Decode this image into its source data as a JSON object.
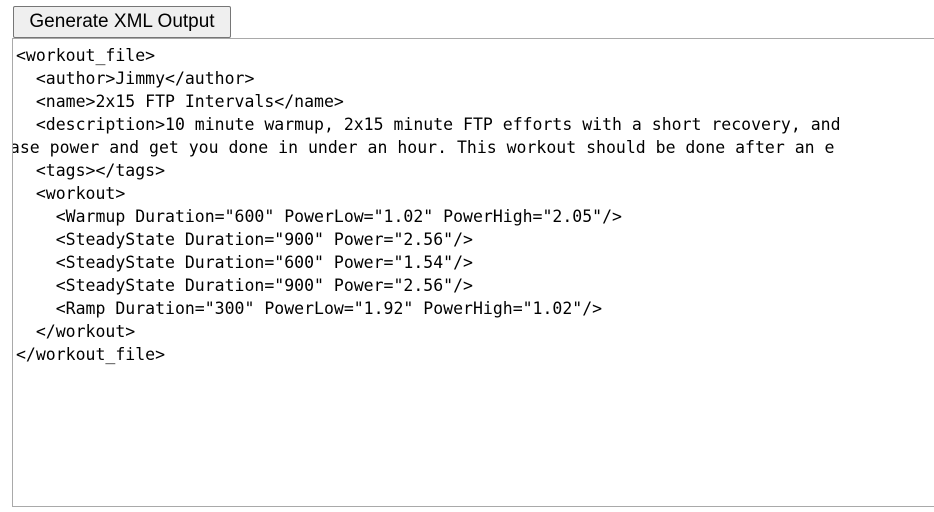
{
  "toolbar": {
    "generate_label": "Generate XML Output"
  },
  "xml_output": {
    "lines": [
      "<workout_file>",
      "  <author>Jimmy</author>",
      "  <name>2x15 FTP Intervals</name>",
      "  <description>10 minute warmup, 2x15 minute FTP efforts with a short recovery, and",
      "base power and get you done in under an hour. This workout should be done after an e",
      "  <tags></tags>",
      "  <workout>",
      "    <Warmup Duration=\"600\" PowerLow=\"1.02\" PowerHigh=\"2.05\"/>",
      "    <SteadyState Duration=\"900\" Power=\"2.56\"/>",
      "    <SteadyState Duration=\"600\" Power=\"1.54\"/>",
      "    <SteadyState Duration=\"900\" Power=\"2.56\"/>",
      "    <Ramp Duration=\"300\" PowerLow=\"1.92\" PowerHigh=\"1.02\"/>",
      "  </workout>",
      "</workout_file>"
    ]
  }
}
